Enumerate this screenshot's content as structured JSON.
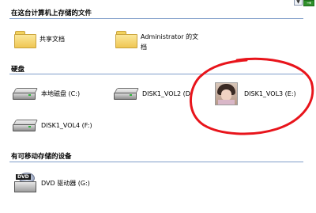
{
  "sections": {
    "files_title": "在这台计算机上存储的文件",
    "hdd_title": "硬盘",
    "removable_title": "有可移动存储的设备"
  },
  "folders": {
    "shared": "共享文档",
    "admin_line1": "Administrator 的文",
    "admin_line2": "档"
  },
  "drives": {
    "c": "本地磁盘 (C:)",
    "vol2": "DISK1_VOL2 (D",
    "vol3": "DISK1_VOL3 (E:)",
    "vol4": "DISK1_VOL4 (F:)",
    "dvd": "DVD 驱动器 (G:)"
  },
  "icons": {
    "folder": "folder-icon",
    "drive": "hard-drive-icon",
    "dvd": "dvd-drive-icon",
    "photo": "drive-photo-icon",
    "scroll": "scroll-down-icon",
    "go": "go-arrow-icon"
  },
  "colors": {
    "annotation_ring": "#e8141b",
    "section_rule": "#7f9dc9",
    "go_button": "#2f8f2a"
  },
  "go_label": "→"
}
